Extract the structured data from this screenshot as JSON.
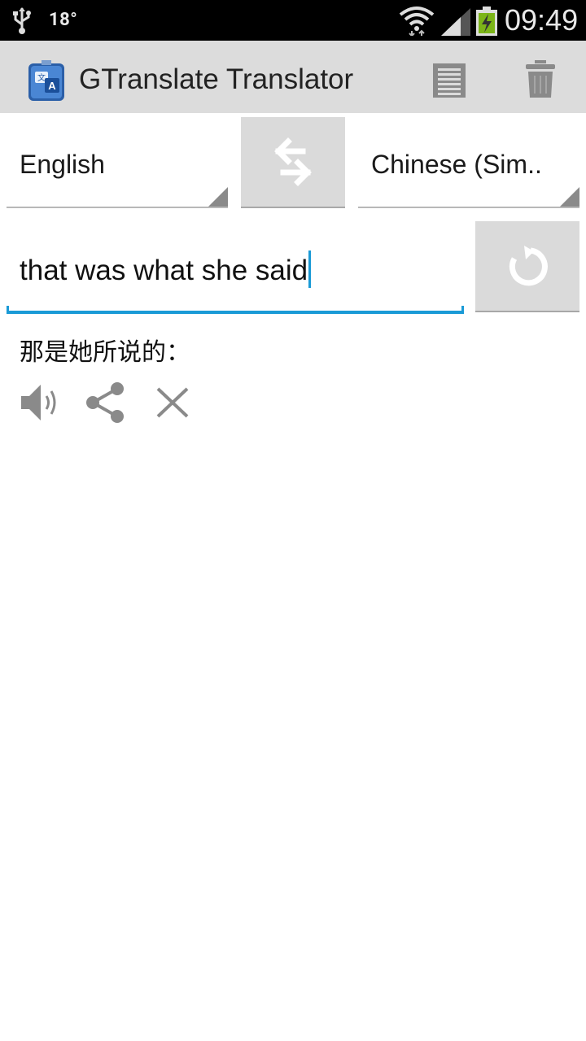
{
  "status_bar": {
    "temperature": "18°",
    "time": "09:49"
  },
  "action_bar": {
    "title": "GTranslate Translator",
    "icons": [
      "app-icon",
      "history-list-icon",
      "trash-icon"
    ]
  },
  "languages": {
    "from": "English",
    "to": "Chinese (Sim.."
  },
  "input": {
    "value": "that was what she said"
  },
  "result": {
    "text": "那是她所说的："
  },
  "colors": {
    "accent": "#1a9ad6",
    "action_bar_bg": "#dcdcdc",
    "button_bg": "#dadada",
    "status_bar_bg": "#000000"
  }
}
